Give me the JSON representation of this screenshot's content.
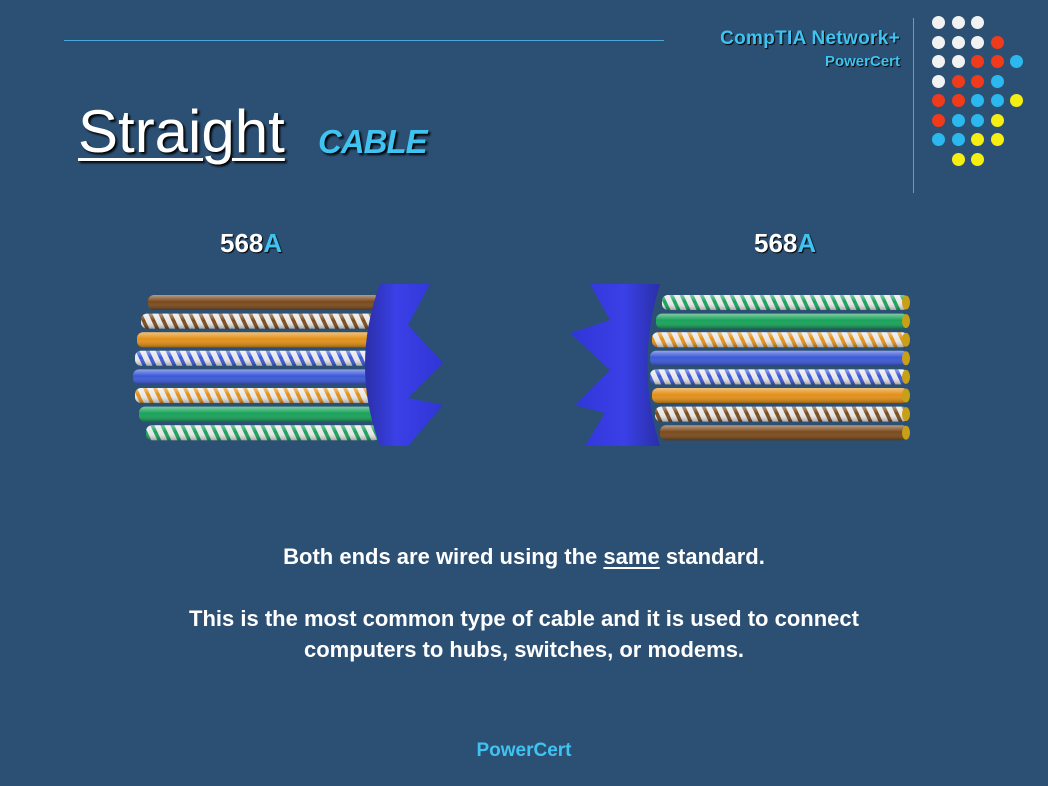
{
  "brand": {
    "line1": "CompTIA Network+",
    "line2": "PowerCert"
  },
  "title": {
    "main": "Straight",
    "sub": "CABLE"
  },
  "left_end": {
    "standard_prefix": "568",
    "standard_letter": "A"
  },
  "right_end": {
    "standard_prefix": "568",
    "standard_letter": "A"
  },
  "caption": {
    "line1_before": "Both ends are wired using the ",
    "line1_emph": "same",
    "line1_after": " standard.",
    "line2": "This is the most common type of cable and it is used to connect",
    "line3": "computers to hubs, switches, or modems."
  },
  "footer": {
    "text": "PowerCert"
  },
  "colors": {
    "background": "#2c5074",
    "accent": "#3fc3f0",
    "jacket": "#2f35d6",
    "dot_white": "#f2f2f2",
    "dot_red": "#ef3a1c",
    "dot_blue": "#2ab8ee",
    "dot_yellow": "#f4ee13"
  },
  "wires_left_top_to_bottom": [
    "brown",
    "white-brown",
    "orange",
    "white-blue",
    "blue",
    "white-orange",
    "green",
    "white-green"
  ],
  "wires_right_top_to_bottom": [
    "white-green",
    "green",
    "white-orange",
    "blue",
    "white-blue",
    "orange",
    "white-brown",
    "brown"
  ],
  "dot_grid_rows": [
    [
      "w",
      "w",
      "w"
    ],
    [
      "w",
      "w",
      "w",
      "r"
    ],
    [
      "w",
      "w",
      "r",
      "r",
      "b"
    ],
    [
      "w",
      "r",
      "r",
      "b"
    ],
    [
      "r",
      "r",
      "b",
      "b",
      "y"
    ],
    [
      "r",
      "b",
      "b",
      "y"
    ],
    [
      "b",
      "b",
      "y",
      "y"
    ],
    [
      "y",
      "y"
    ]
  ]
}
